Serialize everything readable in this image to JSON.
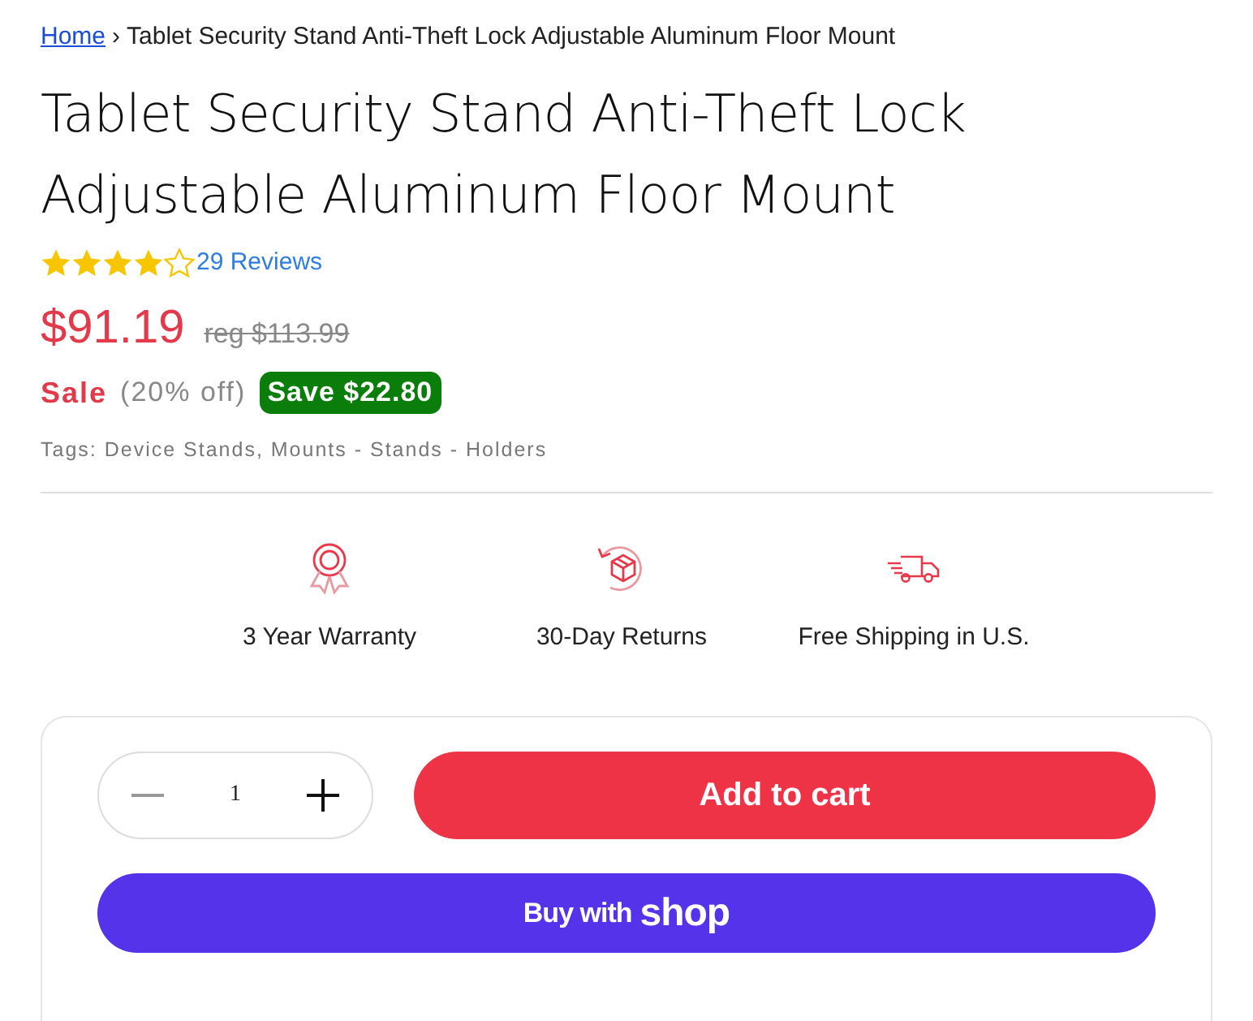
{
  "breadcrumb": [
    {
      "label": "Home",
      "link": true
    },
    {
      "label": "Tablet Security Stand Anti-Theft Lock Adjustable Aluminum Floor Mount",
      "link": false
    }
  ],
  "breadcrumb_separator": "›",
  "title": "Tablet Security Stand Anti-Theft Lock Adjustable Aluminum Floor Mount",
  "rating": {
    "stars": 4,
    "reviews": "29 Reviews"
  },
  "price": {
    "sale": "$91.19",
    "regular": "reg $113.99"
  },
  "sale": {
    "label": "Sale",
    "discount": "(20% off)",
    "badge": "Save $22.80"
  },
  "tags": "Tags: Device Stands, Mounts - Stands - Holders",
  "features": [
    {
      "kind": "award",
      "label": "3 Year Warranty"
    },
    {
      "kind": "returns",
      "label": "30-Day Returns"
    },
    {
      "kind": "truck",
      "label": "Free Shipping in U.S."
    }
  ],
  "quantity": {
    "value": "1",
    "decrease_disabled": true
  },
  "add_to_cart": "Add to cart",
  "buy_with": {
    "text": "Buy with",
    "brand": "shop"
  }
}
